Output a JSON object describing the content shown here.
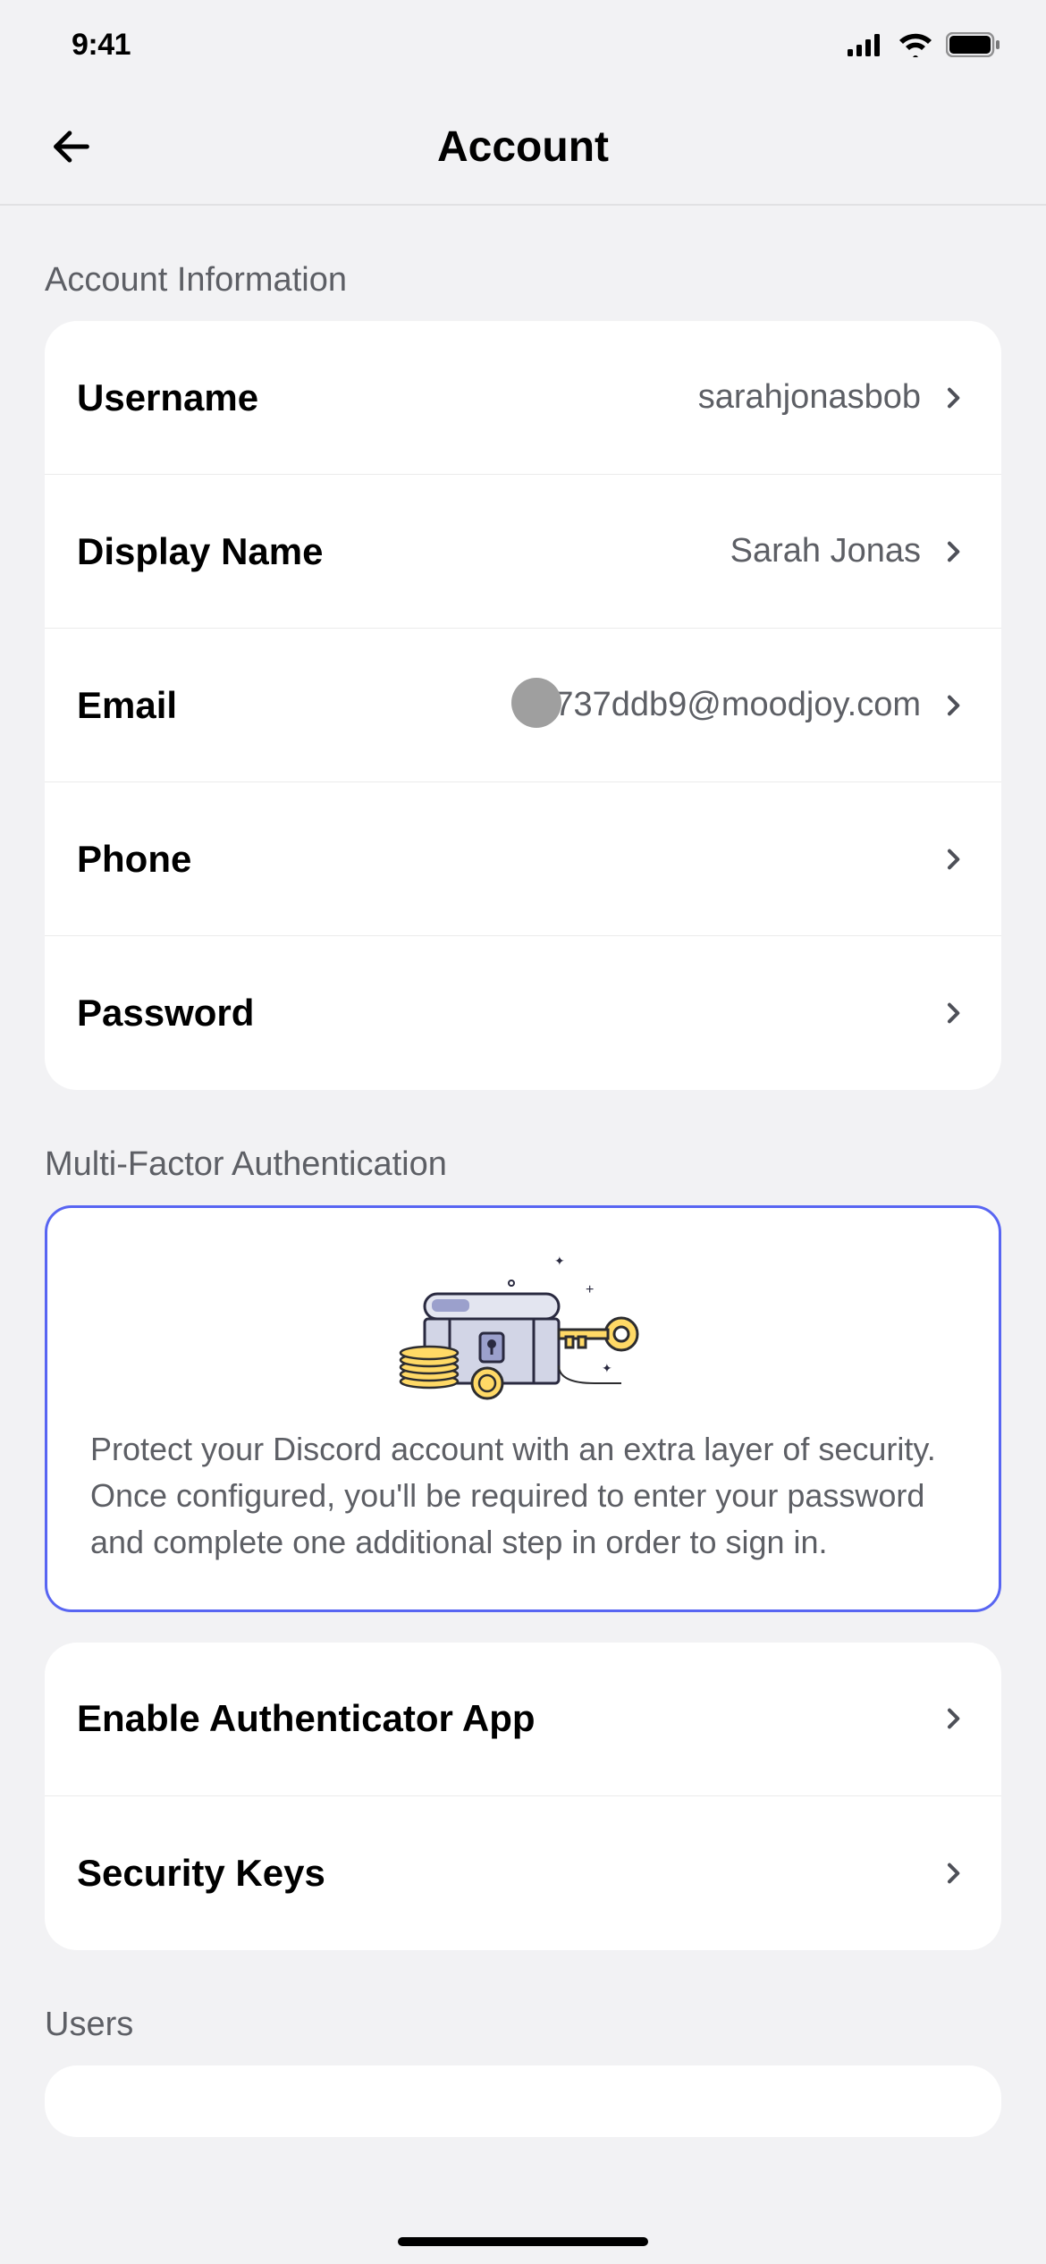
{
  "statusBar": {
    "time": "9:41"
  },
  "header": {
    "title": "Account"
  },
  "sections": {
    "accountInfo": {
      "title": "Account Information",
      "rows": {
        "username": {
          "label": "Username",
          "value": "sarahjonasbob"
        },
        "displayName": {
          "label": "Display Name",
          "value": "Sarah Jonas"
        },
        "email": {
          "label": "Email",
          "value": "9737ddb9@moodjoy.com"
        },
        "phone": {
          "label": "Phone",
          "value": ""
        },
        "password": {
          "label": "Password",
          "value": ""
        }
      }
    },
    "mfa": {
      "title": "Multi-Factor Authentication",
      "description": "Protect your Discord account with an extra layer of security. Once configured, you'll be required to enter your password and complete one additional step in order to sign in.",
      "rows": {
        "authenticator": {
          "label": "Enable Authenticator App"
        },
        "securityKeys": {
          "label": "Security Keys"
        }
      }
    },
    "users": {
      "title": "Users"
    }
  }
}
